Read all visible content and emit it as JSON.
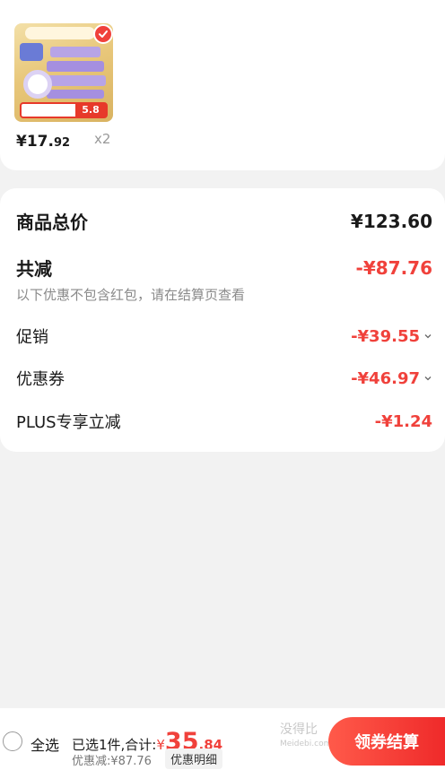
{
  "product": {
    "unit_price_int": "¥17.",
    "unit_price_dec": "92",
    "quantity": "x2",
    "thumb_badge_price": "5.8",
    "selected": true
  },
  "summary": {
    "total_label": "商品总价",
    "total_value": "¥123.60",
    "reduce_label": "共减",
    "reduce_value": "-¥87.76",
    "note": "以下优惠不包含红包，请在结算页查看",
    "promo_label": "促销",
    "promo_value": "-¥39.55",
    "coupon_label": "优惠券",
    "coupon_value": "-¥46.97",
    "plus_label": "PLUS专享立减",
    "plus_value": "-¥1.24"
  },
  "bottom_bar": {
    "select_all_label": "全选",
    "selected_count_text": "已选1件,合计:",
    "currency": "¥",
    "total_int": "35",
    "total_dec": ".84",
    "discount_text": "优惠减:¥87.76",
    "detail_button": "优惠明细",
    "checkout_button": "领券结算",
    "watermark_text": "没得比",
    "watermark_sub": "Meidebi.com"
  },
  "colors": {
    "accent_red": "#f0413b",
    "background": "#f2f2f2",
    "card": "#ffffff"
  }
}
